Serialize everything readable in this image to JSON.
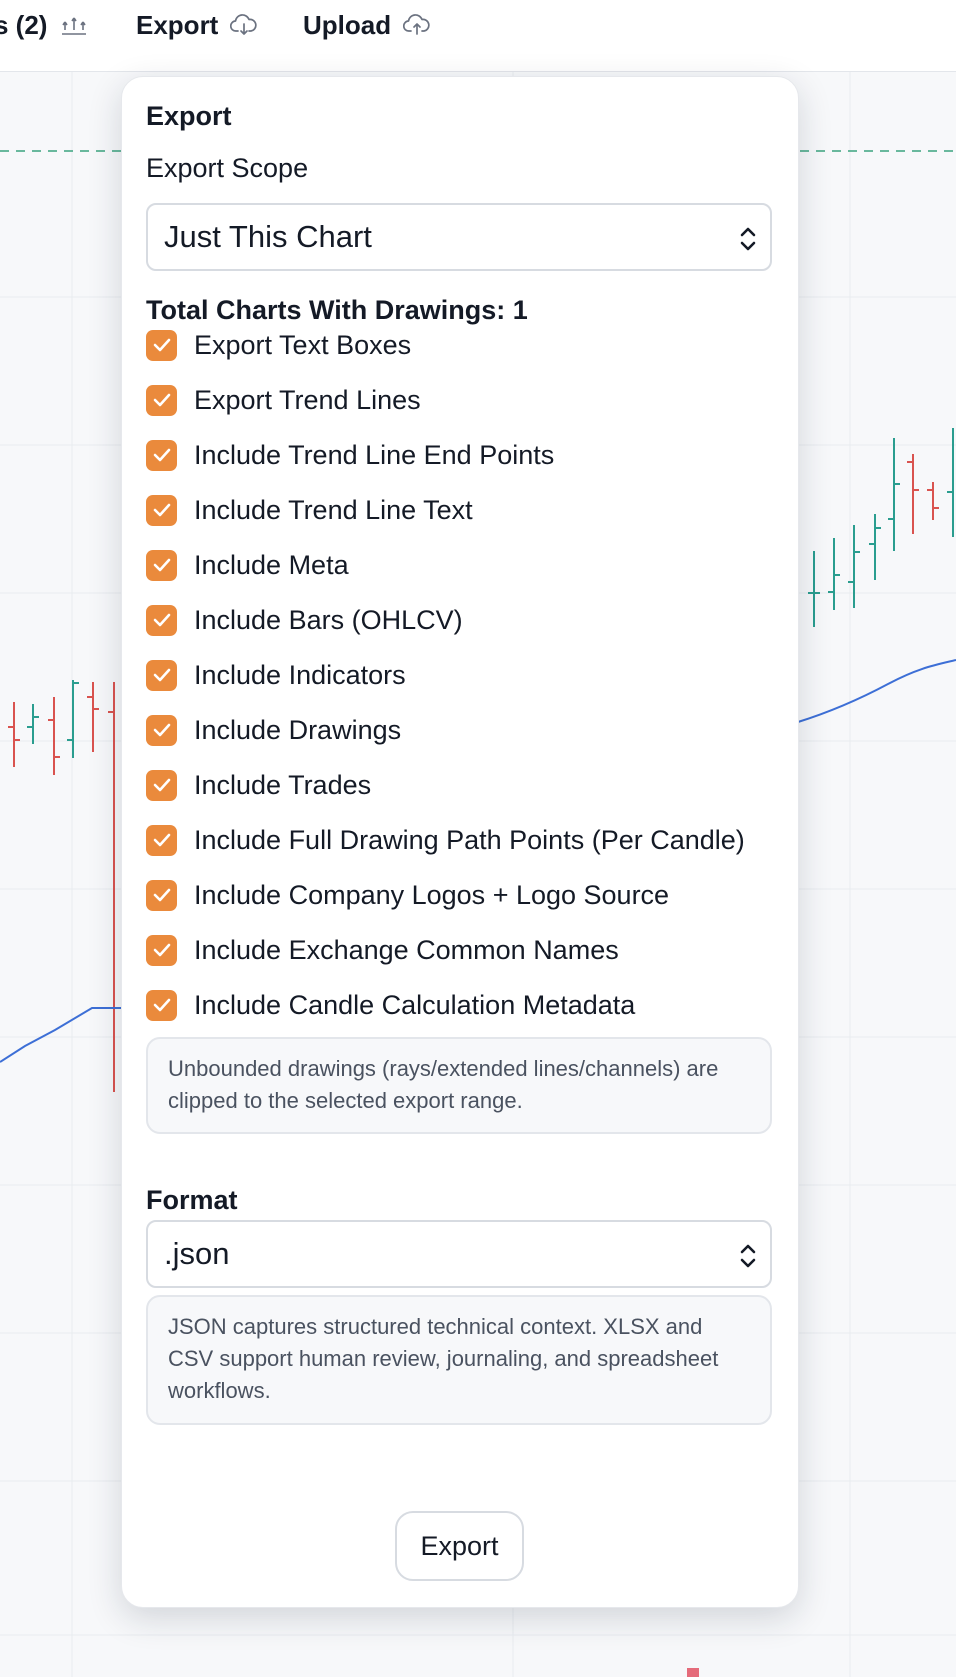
{
  "toolbar": {
    "layers_label": "s (2)",
    "layers_icon": "layers-icon",
    "export_label": "Export",
    "export_icon": "cloud-download-icon",
    "upload_label": "Upload",
    "upload_icon": "cloud-upload-icon"
  },
  "panel": {
    "title": "Export",
    "scope_label": "Export Scope",
    "scope_value": "Just This Chart",
    "total_charts": "Total Charts With Drawings: 1",
    "options": [
      {
        "label": "Export Text Boxes",
        "checked": true
      },
      {
        "label": "Export Trend Lines",
        "checked": true
      },
      {
        "label": "Include Trend Line End Points",
        "checked": true
      },
      {
        "label": "Include Trend Line Text",
        "checked": true
      },
      {
        "label": "Include Meta",
        "checked": true
      },
      {
        "label": "Include Bars (OHLCV)",
        "checked": true
      },
      {
        "label": "Include Indicators",
        "checked": true
      },
      {
        "label": "Include Drawings",
        "checked": true
      },
      {
        "label": "Include Trades",
        "checked": true
      },
      {
        "label": "Include Full Drawing Path Points (Per Candle)",
        "checked": true
      },
      {
        "label": "Include Company Logos + Logo Source",
        "checked": true
      },
      {
        "label": "Include Exchange Common Names",
        "checked": true
      },
      {
        "label": "Include Candle Calculation Metadata",
        "checked": true
      }
    ],
    "unbounded_note": "Unbounded drawings (rays/extended lines/channels) are clipped to the selected export range.",
    "format_label": "Format",
    "format_value": ".json",
    "format_note": "JSON captures structured technical context. XLSX and CSV support human review, journaling, and spreadsheet workflows.",
    "export_button": "Export"
  },
  "colors": {
    "accent_checkbox": "#ea8a3c",
    "candle_up": "#26a69a",
    "candle_down": "#ef5350",
    "indicator_line": "#3d6fd6"
  }
}
